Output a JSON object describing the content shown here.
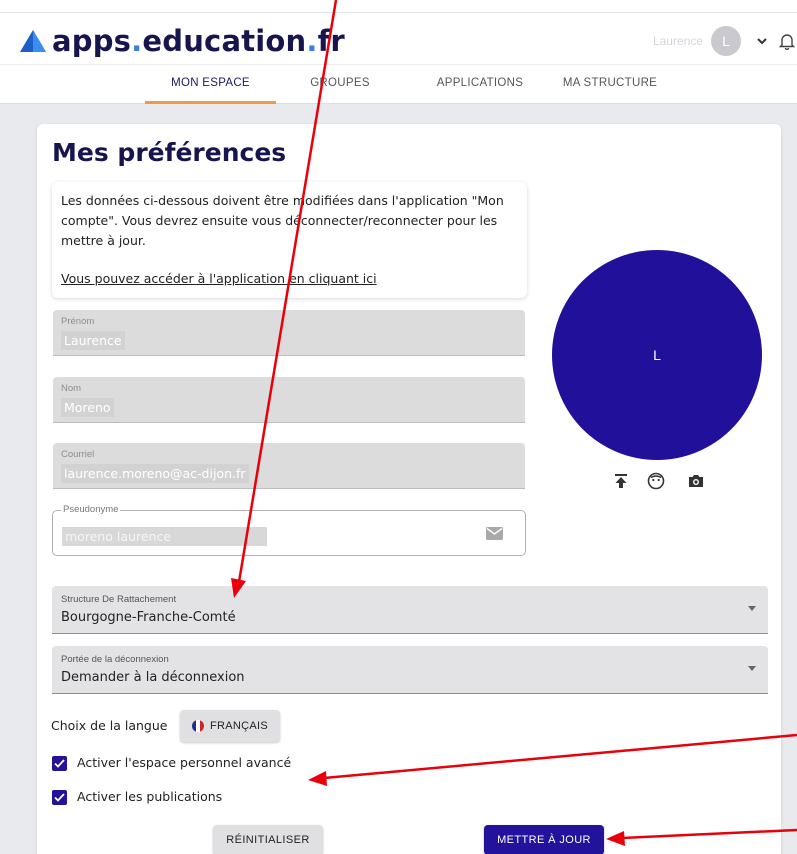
{
  "header": {
    "logo": {
      "part1": "apps",
      "dot1": ".",
      "part2": "education",
      "dot2": ".",
      "part3": "fr"
    },
    "user_name": "Laurence",
    "user_initial": "L"
  },
  "tabs": [
    {
      "label": "MON ESPACE",
      "active": true
    },
    {
      "label": "GROUPES",
      "active": false
    },
    {
      "label": "APPLICATIONS",
      "active": false
    },
    {
      "label": "MA STRUCTURE",
      "active": false
    }
  ],
  "page": {
    "title": "Mes préférences"
  },
  "info": {
    "message": "Les données ci-dessous doivent être modifiées dans l'application \"Mon compte\". Vous devrez ensuite vous déconnecter/reconnecter pour les mettre à jour.",
    "link": "Vous pouvez accéder à l'application en cliquant ici"
  },
  "fields": {
    "prenom": {
      "label": "Prénom",
      "value": "Laurence"
    },
    "nom": {
      "label": "Nom",
      "value": "Moreno"
    },
    "courriel": {
      "label": "Courriel",
      "value": "laurence.moreno@ac-dijon.fr"
    },
    "pseudo": {
      "label": "Pseudonyme",
      "value": "moreno laurence"
    }
  },
  "avatar": {
    "initial": "L",
    "color": "#20109a",
    "tools": [
      "upload-icon",
      "face-icon",
      "camera-icon"
    ]
  },
  "selects": {
    "structure": {
      "label": "Structure De Rattachement",
      "value": "Bourgogne-Franche-Comté"
    },
    "deconnexion": {
      "label": "Portée de la déconnexion",
      "value": "Demander à la déconnexion"
    }
  },
  "language": {
    "label": "Choix de la langue",
    "button": "FRANÇAIS"
  },
  "checkboxes": [
    {
      "label": "Activer l'espace personnel avancé",
      "checked": true
    },
    {
      "label": "Activer les publications",
      "checked": true
    }
  ],
  "buttons": {
    "reset": "RÉINITIALISER",
    "update": "METTRE À JOUR"
  },
  "colors": {
    "brand_dark": "#17154e",
    "primary": "#22129c",
    "accent_tab": "#f09a45",
    "annotation_arrow": "#e8000b"
  }
}
